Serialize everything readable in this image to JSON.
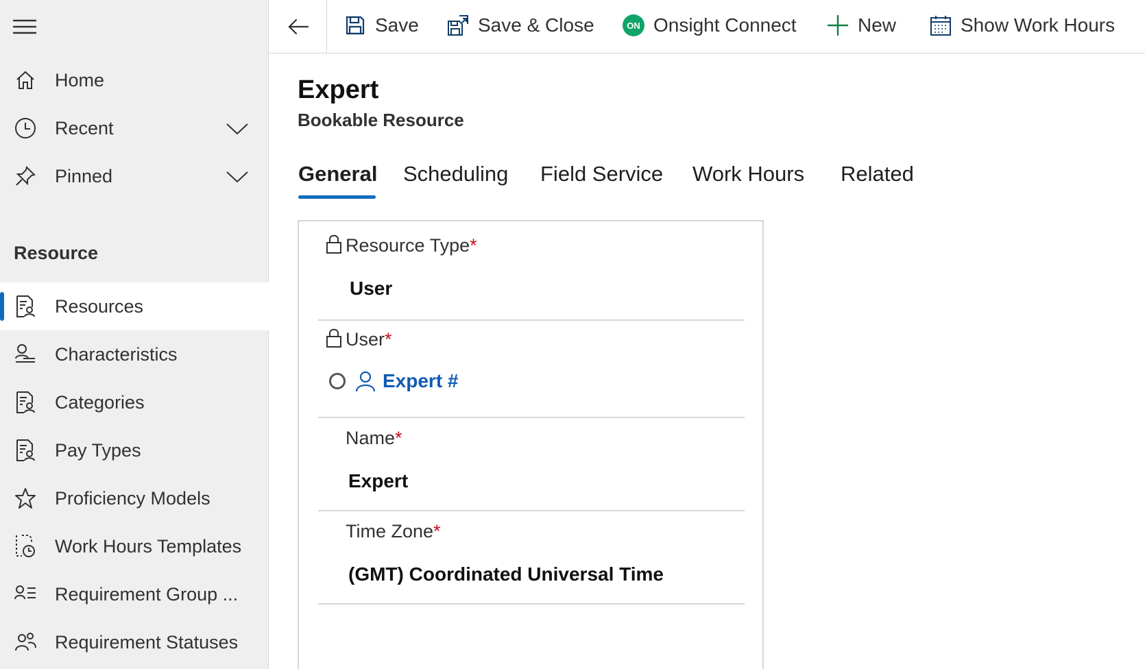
{
  "sidebar": {
    "menu_icon": "hamburger-icon",
    "top_items": [
      {
        "label": "Home",
        "icon": "home-icon"
      },
      {
        "label": "Recent",
        "icon": "clock-icon"
      },
      {
        "label": "Pinned",
        "icon": "pin-icon"
      }
    ],
    "section_label": "Resource",
    "items": [
      {
        "label": "Resources",
        "icon": "resource-document-icon",
        "active": true
      },
      {
        "label": "Characteristics",
        "icon": "person-badge-icon"
      },
      {
        "label": "Categories",
        "icon": "resource-document-icon"
      },
      {
        "label": "Pay Types",
        "icon": "resource-document-icon"
      },
      {
        "label": "Proficiency Models",
        "icon": "star-icon"
      },
      {
        "label": "Work Hours Templates",
        "icon": "document-clock-icon"
      },
      {
        "label": "Requirement Group ...",
        "icon": "person-list-icon"
      },
      {
        "label": "Requirement Statuses",
        "icon": "people-icon"
      }
    ]
  },
  "commandbar": {
    "back_icon": "back-arrow-icon",
    "buttons": [
      {
        "label": "Save",
        "icon": "save-icon"
      },
      {
        "label": "Save & Close",
        "icon": "save-close-icon"
      },
      {
        "label": "Onsight Connect",
        "icon": "onsight-icon",
        "badge": "ON",
        "badge_color": "#10a46b"
      },
      {
        "label": "New",
        "icon": "plus-icon",
        "color": "#107c41"
      },
      {
        "label": "Show Work Hours",
        "icon": "calendar-icon"
      }
    ]
  },
  "header": {
    "title": "Expert",
    "subtitle": "Bookable Resource"
  },
  "tabs": [
    {
      "label": "General",
      "active": true
    },
    {
      "label": "Scheduling"
    },
    {
      "label": "Field Service"
    },
    {
      "label": "Work Hours"
    },
    {
      "label": "Related"
    }
  ],
  "form": {
    "required_marker": "*",
    "fields": [
      {
        "label": "Resource Type",
        "value": "User",
        "locked": true
      },
      {
        "label": "User",
        "value": "Expert #",
        "locked": true,
        "lookup": true
      },
      {
        "label": "Name",
        "value": "Expert"
      },
      {
        "label": "Time Zone",
        "value": "(GMT) Coordinated Universal Time"
      }
    ]
  },
  "colors": {
    "accent": "#0f6cbd",
    "link": "#0f5cb2",
    "required": "#c50f1f",
    "sidebar_bg": "#efefef"
  }
}
